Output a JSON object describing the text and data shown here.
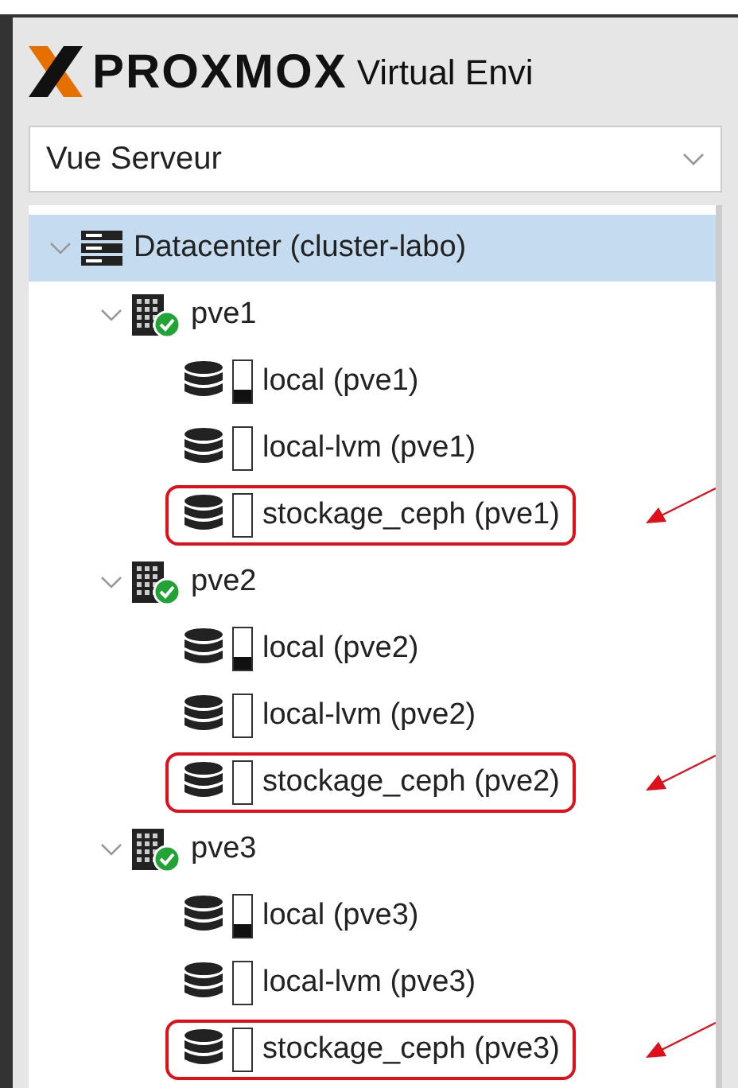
{
  "header": {
    "logo": "PROXMOX",
    "product": "Virtual Envi"
  },
  "view_select": {
    "value": "Vue Serveur"
  },
  "tree": [
    {
      "kind": "datacenter",
      "label": "Datacenter (cluster-labo)",
      "selected": true,
      "expanded": true,
      "children": [
        {
          "kind": "node",
          "label": "pve1",
          "selected": false,
          "expanded": true,
          "online": true,
          "children": [
            {
              "kind": "storage",
              "label": "local (pve1)",
              "selected": false,
              "level": 0.3,
              "highlighted": false
            },
            {
              "kind": "storage",
              "label": "local-lvm (pve1)",
              "selected": false,
              "highlighted": false
            },
            {
              "kind": "storage",
              "label": "stockage_ceph (pve1)",
              "selected": false,
              "highlighted": true
            }
          ]
        },
        {
          "kind": "node",
          "label": "pve2",
          "selected": false,
          "expanded": true,
          "online": true,
          "children": [
            {
              "kind": "storage",
              "label": "local (pve2)",
              "selected": false,
              "level": 0.3,
              "highlighted": false
            },
            {
              "kind": "storage",
              "label": "local-lvm (pve2)",
              "selected": false,
              "highlighted": false
            },
            {
              "kind": "storage",
              "label": "stockage_ceph (pve2)",
              "selected": false,
              "highlighted": true
            }
          ]
        },
        {
          "kind": "node",
          "label": "pve3",
          "selected": false,
          "expanded": true,
          "online": true,
          "children": [
            {
              "kind": "storage",
              "label": "local (pve3)",
              "selected": false,
              "level": 0.3,
              "highlighted": false
            },
            {
              "kind": "storage",
              "label": "local-lvm (pve3)",
              "selected": false,
              "highlighted": false
            },
            {
              "kind": "storage",
              "label": "stockage_ceph (pve3)",
              "selected": false,
              "highlighted": true
            }
          ]
        }
      ]
    }
  ]
}
